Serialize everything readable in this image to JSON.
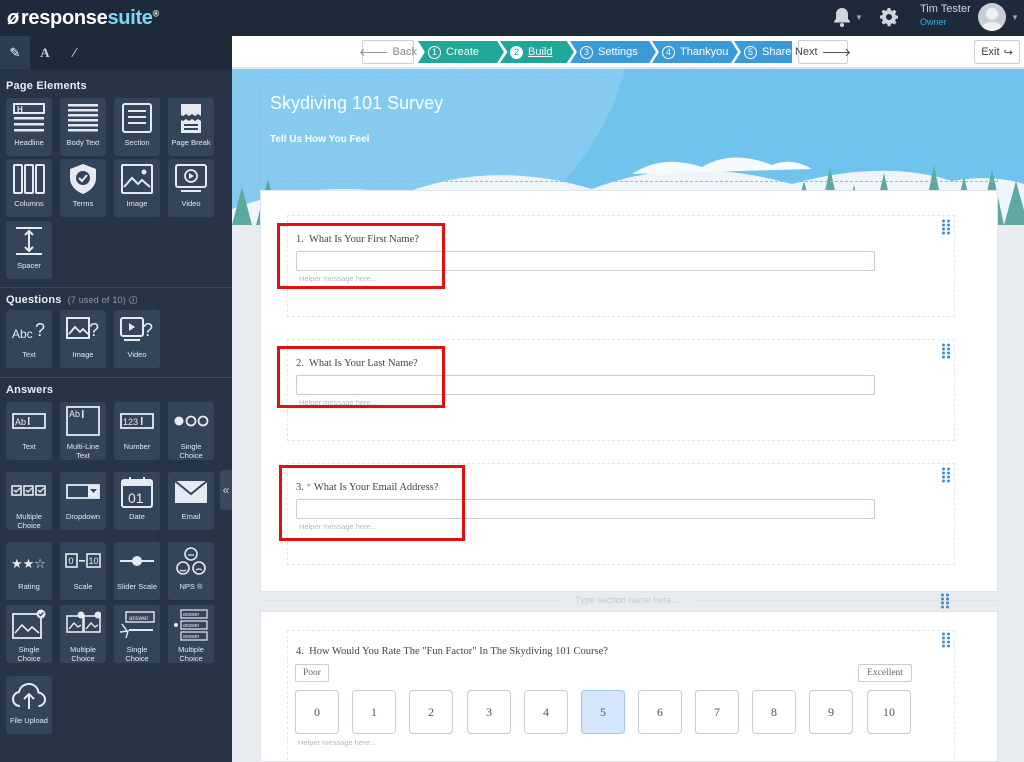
{
  "app": {
    "logo_main": "response",
    "logo_suffix": "suite",
    "logo_mark": "ø",
    "logo_reg": "®"
  },
  "user": {
    "name": "Tim Tester",
    "role": "Owner"
  },
  "sidebar": {
    "tabs": [
      "edit-icon",
      "font-icon",
      "brush-icon"
    ],
    "page_elements": {
      "title": "Page Elements",
      "items": [
        "Headline",
        "Body Text",
        "Section",
        "Page Break",
        "Columns",
        "Terms",
        "Image",
        "Video",
        "Spacer"
      ]
    },
    "questions": {
      "title": "Questions",
      "count": "(7 used of 10)",
      "items": [
        "Text",
        "Image",
        "Video"
      ]
    },
    "answers": {
      "title": "Answers",
      "items": [
        "Text",
        "Multi-Line Text",
        "Number",
        "Single Choice",
        "Multiple Choice",
        "Dropdown",
        "Date",
        "Email",
        "Rating",
        "Scale",
        "Slider Scale",
        "NPS ®",
        "Single Choice",
        "Multiple Choice",
        "Single Choice",
        "Multiple Choice",
        "File Upload"
      ]
    }
  },
  "stepper": {
    "back": "Back",
    "next": "Next",
    "exit": "Exit",
    "steps": [
      {
        "num": "1",
        "label": "Create"
      },
      {
        "num": "2",
        "label": "Build"
      },
      {
        "num": "3",
        "label": "Settings"
      },
      {
        "num": "4",
        "label": "Thankyou"
      },
      {
        "num": "5",
        "label": "Share"
      }
    ],
    "colors": {
      "done": "#1fa79a",
      "current": "#1fa79a",
      "todo": "#3b9bd9"
    }
  },
  "survey": {
    "title": "Skydiving 101 Survey",
    "subtitle": "Tell Us How You Feel",
    "questions": [
      {
        "num": "1.",
        "label": "What Is Your First Name?",
        "helper": "Helper message here..."
      },
      {
        "num": "2.",
        "label": "What Is Your Last Name?",
        "helper": "Helper message here..."
      },
      {
        "num": "3.",
        "label": "What Is Your Email Address?",
        "required_mark": "*",
        "helper": "Helper message here..."
      }
    ],
    "section_placeholder": "Type section name here...",
    "rating": {
      "num": "4.",
      "label": "How Would You Rate The \"Fun Factor\" In The Skydiving 101 Course?",
      "low": "Poor",
      "high": "Excellent",
      "options": [
        "0",
        "1",
        "2",
        "3",
        "4",
        "5",
        "6",
        "7",
        "8",
        "9",
        "10"
      ],
      "selected": "5",
      "helper": "Helper message here..."
    }
  }
}
